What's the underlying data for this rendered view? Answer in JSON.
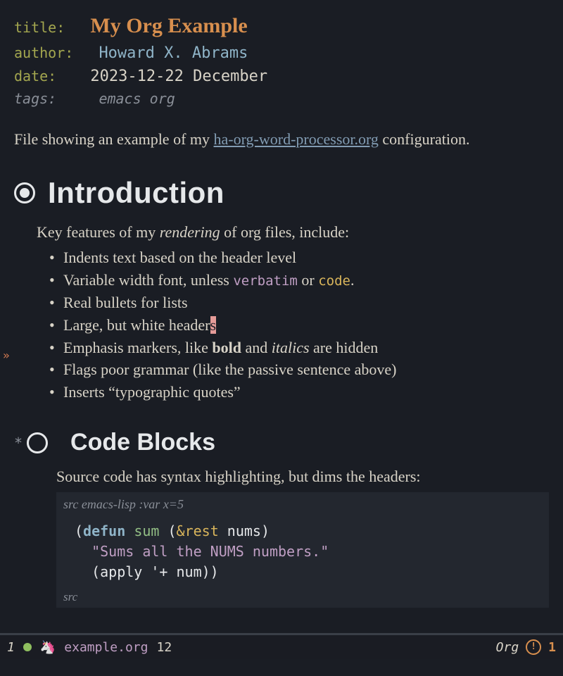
{
  "meta": {
    "title_key": "title:",
    "title_val": "My Org Example",
    "author_key": "author:",
    "author_val": "Howard X. Abrams",
    "date_key": "date:",
    "date_val": "2023-12-22 December",
    "tags_key": "tags:",
    "tags_val": "emacs org"
  },
  "intro": {
    "para_pre": "File showing an example of my ",
    "link_text": "ha-org-word-processor.org",
    "para_post": " configuration.",
    "heading": "Introduction",
    "lead_pre": "Key features of my ",
    "lead_em": "rendering",
    "lead_post": " of org files, include:",
    "b1": "Indents text based on the header level",
    "b2_pre": "Variable width font, unless ",
    "b2_verbatim": "verbatim",
    "b2_mid": " or ",
    "b2_code": "code",
    "b2_post": ".",
    "b3": "Real bullets for lists",
    "b4_pre": "Large, but white header",
    "b4_cursor": "s",
    "b5_pre": "Emphasis markers, like ",
    "b5_bold": "bold",
    "b5_mid": " and ",
    "b5_italic": "italics",
    "b5_post": " are hidden",
    "b6": "Flags poor grammar (like the passive sentence above)",
    "b7": "Inserts “typographic quotes”"
  },
  "codeblocks": {
    "heading": "Code Blocks",
    "star": "*",
    "para": "Source code has syntax highlighting, but dims the headers:",
    "src_label": "src",
    "src_lang": " emacs-lisp :var x=5",
    "line1_open": "(",
    "line1_defun": "defun",
    "line1_sp1": " ",
    "line1_name": "sum",
    "line1_sp2": " (",
    "line1_amp": "&rest",
    "line1_sp3": " ",
    "line1_arg": "nums",
    "line1_close": ")",
    "line2_indent": "  ",
    "line2_doc": "\"Sums all the NUMS numbers.\"",
    "line3_indent": "  ",
    "line3_open": "(",
    "line3_apply": "apply ",
    "line3_quote": "'+ ",
    "line3_arg": "num",
    "line3_close": "))",
    "src_end": "src"
  },
  "modeline": {
    "index": "1",
    "buffer": "example.org",
    "line": "12",
    "mode": "Org",
    "warn_count": "1",
    "warn_glyph": "!"
  },
  "fringe": {
    "marker": "»"
  }
}
